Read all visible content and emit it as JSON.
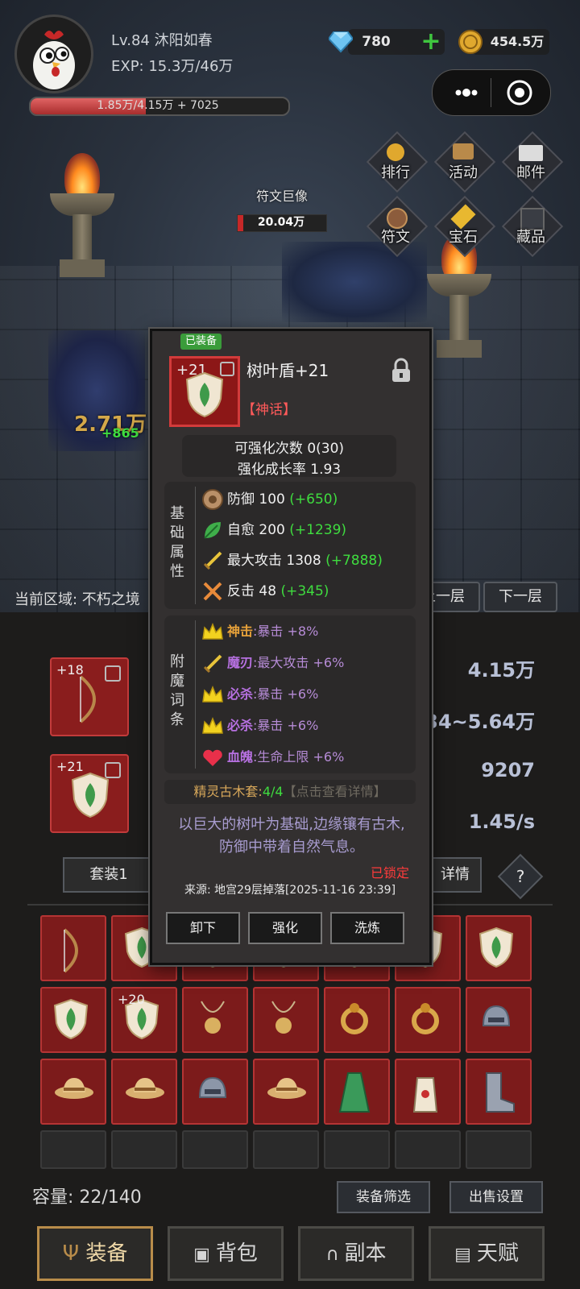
{
  "player": {
    "name": "Lv.84 沐阳如春",
    "exp": "EXP: 15.3万/46万",
    "hp_text": "1.85万/4.15万 + 7025",
    "hp_fraction": 0.446
  },
  "resources": {
    "gems": "780",
    "gold": "454.5万"
  },
  "menu": {
    "rank": "排行",
    "events": "活动",
    "mail": "邮件",
    "runes": "符文",
    "gems": "宝石",
    "collection": "藏品"
  },
  "boss": {
    "name": "符文巨像",
    "hp": "20.04万",
    "hp_fraction": 0.06
  },
  "battle": {
    "area": "当前区域: 不朽之境",
    "prev_floor": "上一层",
    "next_floor": "下一层",
    "floating_dmg": "2.71万",
    "floating_heal": "+865"
  },
  "equipped_slots": [
    {
      "enh": "+18",
      "icon": "bow-icon"
    },
    {
      "enh": "+21",
      "icon": "leaf-shield-icon"
    }
  ],
  "stats": {
    "s1": "4.15万",
    "s2": "334~5.64万",
    "s3": "9207",
    "s4": "1.45/s"
  },
  "tabs": {
    "set": "套装1",
    "details": "详情",
    "help": "?"
  },
  "grid_rows": [
    [
      {
        "icon": "bow-icon"
      },
      {
        "icon": "leaf-shield-icon"
      },
      {
        "icon": "leaf-shield-icon"
      },
      {
        "icon": "leaf-shield-icon"
      },
      {
        "icon": "leaf-shield-icon"
      },
      {
        "icon": "leaf-shield-icon"
      },
      {
        "icon": "leaf-shield-icon"
      }
    ],
    [
      {
        "icon": "leaf-shield-icon"
      },
      {
        "icon": "leaf-shield-icon",
        "enh": "+20"
      },
      {
        "icon": "necklace-icon"
      },
      {
        "icon": "necklace-icon"
      },
      {
        "icon": "ring-icon"
      },
      {
        "icon": "ring-icon"
      },
      {
        "icon": "helmet-icon"
      }
    ],
    [
      {
        "icon": "straw-hat-icon"
      },
      {
        "icon": "straw-hat-icon"
      },
      {
        "icon": "helmet-icon"
      },
      {
        "icon": "straw-hat-icon"
      },
      {
        "icon": "robe-icon"
      },
      {
        "icon": "apron-icon"
      },
      {
        "icon": "boot-icon"
      }
    ]
  ],
  "inventory": {
    "capacity": "容量: 22/140",
    "filter": "装备筛选",
    "sell": "出售设置"
  },
  "nav": {
    "equipment": "装备",
    "bag": "背包",
    "dungeon": "副本",
    "talent": "天赋"
  },
  "tooltip": {
    "badge": "已装备",
    "enh": "+21",
    "name": "树叶盾+21",
    "rarity": "【神话】",
    "upgrade_count": "可强化次数 0(30)",
    "growth": "强化成长率 1.93",
    "base_title": "基础属性",
    "base": [
      {
        "icon": "defense-icon",
        "label": "防御 100 ",
        "bonus": "(+650)"
      },
      {
        "icon": "regen-leaf-icon",
        "label": "自愈 200 ",
        "bonus": "(+1239)"
      },
      {
        "icon": "sword-icon",
        "label": "最大攻击 1308 ",
        "bonus": "(+7888)"
      },
      {
        "icon": "counter-icon",
        "label": "反击 48 ",
        "bonus": "(+345)"
      }
    ],
    "ench_title": "附魔词条",
    "ench": [
      {
        "icon": "crown-icon",
        "name": "神击",
        "color": "#e8a23a",
        "text": ":暴击 +8%"
      },
      {
        "icon": "sword-icon",
        "name": "魔刃",
        "color": "#b670e0",
        "text": ":最大攻击 +6%"
      },
      {
        "icon": "crown-icon",
        "name": "必杀",
        "color": "#b670e0",
        "text": ":暴击 +6%"
      },
      {
        "icon": "crown-icon",
        "name": "必杀",
        "color": "#b670e0",
        "text": ":暴击 +6%"
      },
      {
        "icon": "heart-icon",
        "name": "血魄",
        "color": "#b670e0",
        "text": ":生命上限 +6%"
      }
    ],
    "set_name": "精灵古木套:",
    "set_count": "4/4",
    "set_hint": "【点击查看详情】",
    "description": "以巨大的树叶为基础,边缘镶有古木,防御中带着自然气息。",
    "locked": "已锁定",
    "source": "来源: 地宫29层掉落[2025-11-16 23:39]",
    "btn_unequip": "卸下",
    "btn_enhance": "强化",
    "btn_reroll": "洗炼"
  },
  "colors": {
    "accent_red": "#d23b3b",
    "bonus_green": "#3fdc3f",
    "mythic_red": "#ff5a5a",
    "set_gold": "#d8a85a",
    "set_count_green": "#3fdc3f"
  }
}
